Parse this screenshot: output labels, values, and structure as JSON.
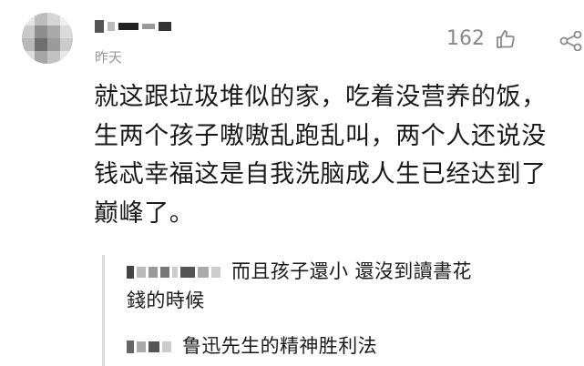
{
  "comment": {
    "timestamp": "昨天",
    "likes": "162",
    "lines": [
      "就这跟垃圾堆似的家，吃着没营养的饭，",
      "生两个孩子嗷嗷乱跑乱叫，两个人还说没",
      "钱忒幸福这是自我洗脑成人生已经达到了",
      "巅峰了。"
    ]
  },
  "replies": [
    {
      "lines": [
        "而且孩子還小 還沒到讀書花",
        "錢的時候"
      ]
    },
    {
      "lines": [
        "鲁迅先生的精神胜利法"
      ]
    }
  ],
  "colors": {
    "text": "#1a1a1a",
    "meta": "#9a9a9a",
    "icon": "#8a8a8a",
    "quote_border": "#dcdcdc"
  },
  "icons": {
    "like": "thumb-up-icon",
    "share": "share-icon",
    "avatar": "blurred-avatar"
  }
}
